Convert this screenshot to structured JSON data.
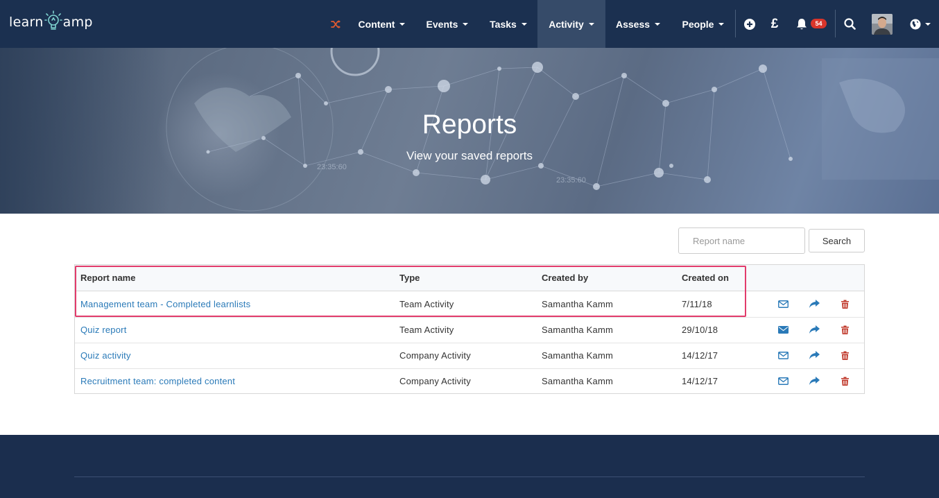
{
  "brand": {
    "left": "learn",
    "right": "amp"
  },
  "nav": {
    "items": [
      {
        "label": "Content"
      },
      {
        "label": "Events"
      },
      {
        "label": "Tasks"
      },
      {
        "label": "Activity"
      },
      {
        "label": "Assess"
      },
      {
        "label": "People"
      }
    ],
    "currency_symbol": "£",
    "notification_count": "54"
  },
  "hero": {
    "title": "Reports",
    "subtitle": "View your saved reports"
  },
  "search": {
    "placeholder": "Report name",
    "button_label": "Search"
  },
  "table": {
    "headers": [
      "Report name",
      "Type",
      "Created by",
      "Created on"
    ],
    "rows": [
      {
        "name": "Management team - Completed learnlists",
        "type": "Team Activity",
        "created_by": "Samantha Kamm",
        "created_on": "7/11/18",
        "email_icon": "envelope-outline"
      },
      {
        "name": "Quiz report",
        "type": "Team Activity",
        "created_by": "Samantha Kamm",
        "created_on": "29/10/18",
        "email_icon": "envelope-solid"
      },
      {
        "name": "Quiz activity",
        "type": "Company Activity",
        "created_by": "Samantha Kamm",
        "created_on": "14/12/17",
        "email_icon": "envelope-outline"
      },
      {
        "name": "Recruitment team: completed content",
        "type": "Company Activity",
        "created_by": "Samantha Kamm",
        "created_on": "14/12/17",
        "email_icon": "envelope-outline"
      }
    ]
  },
  "colors": {
    "navbar": "#1b3050",
    "link": "#2a7ab8",
    "delete": "#c0392b",
    "highlight": "#e23b6b",
    "badge": "#d9352b"
  }
}
